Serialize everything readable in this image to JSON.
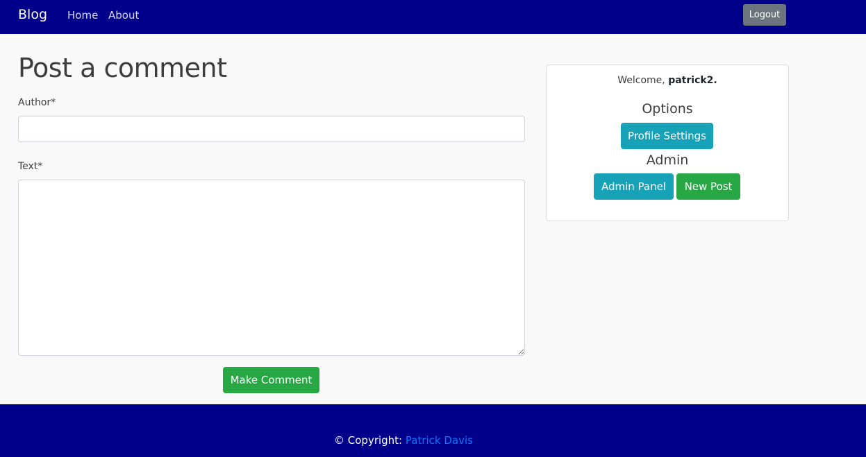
{
  "navbar": {
    "brand": "Blog",
    "links": [
      {
        "label": "Home"
      },
      {
        "label": "About"
      }
    ],
    "logout_label": "Logout",
    "background_color": "#00008b"
  },
  "main": {
    "title": "Post a comment",
    "form": {
      "author_label": "Author*",
      "author_value": "",
      "text_label": "Text*",
      "text_value": "",
      "submit_label": "Make Comment"
    }
  },
  "sidebar": {
    "welcome_prefix": "Welcome, ",
    "username": "patrick2.",
    "options_heading": "Options",
    "profile_settings_label": "Profile Settings",
    "admin_heading": "Admin",
    "admin_panel_label": "Admin Panel",
    "new_post_label": "New Post"
  },
  "footer": {
    "copyright_prefix": "© Copyright: ",
    "author_link": "Patrick Davis"
  }
}
